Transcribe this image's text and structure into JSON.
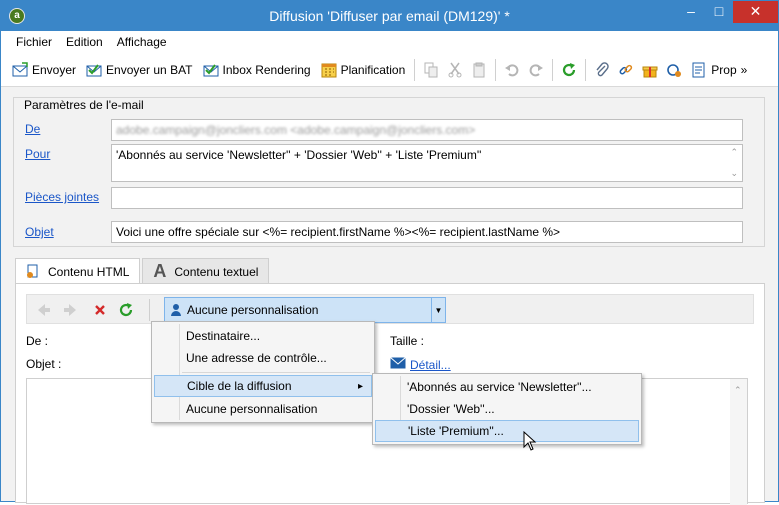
{
  "window": {
    "title": "Diffusion 'Diffuser par email (DM129)' *",
    "app_icon": "adobe-campaign-logo",
    "controls": {
      "minimize": "–",
      "maximize": "□",
      "close": "✕"
    }
  },
  "menubar": [
    "Fichier",
    "Edition",
    "Affichage"
  ],
  "toolbar": {
    "send": "Envoyer",
    "send_proof": "Envoyer un BAT",
    "inbox_rendering": "Inbox Rendering",
    "schedule": "Planification",
    "properties": "Prop",
    "overflow": "»"
  },
  "params": {
    "legend": "Paramètres de l'e-mail",
    "from_label": "De",
    "from_value": "adobe.campaign@joncliers.com <adobe.campaign@joncliers.com>",
    "to_label": "Pour",
    "to_value": "'Abonnés au service 'Newsletter'' + 'Dossier 'Web'' + 'Liste 'Premium''",
    "attachments_label": "Pièces jointes",
    "attachments_value": "",
    "subject_label": "Objet",
    "subject_value": "Voici une offre spéciale sur <%= recipient.firstName %><%= recipient.lastName %>"
  },
  "tabs": {
    "html": "Contenu HTML",
    "text": "Contenu textuel"
  },
  "editor": {
    "personalization_combo": "Aucune personnalisation",
    "from_label": "De :",
    "subject_label": "Objet :",
    "size_label": "Taille :",
    "detail_link": "Détail..."
  },
  "context_menu": {
    "recipient": "Destinataire...",
    "seed_address": "Une adresse de contrôle...",
    "target": "Cible de la diffusion",
    "none": "Aucune personnalisation",
    "submenu_arrow": "▸"
  },
  "submenu": {
    "newsletter": "'Abonnés au service 'Newsletter''...",
    "web": "'Dossier 'Web''...",
    "premium": "'Liste 'Premium''..."
  },
  "colors": {
    "titlebar": "#3a86c8",
    "close_button": "#c7312b",
    "link": "#1a56c8",
    "highlight": "#d5e6f7"
  }
}
